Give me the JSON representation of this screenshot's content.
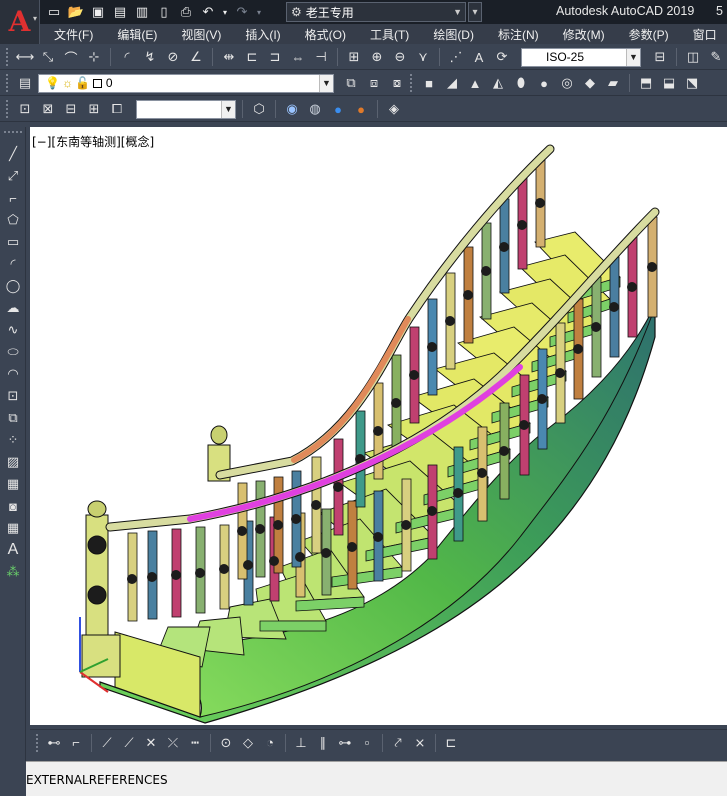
{
  "titlebar": {
    "logo_letter": "A",
    "workspace": "老王专用",
    "app_title": "Autodesk AutoCAD 2019",
    "app_title_extra": "5"
  },
  "menubar": {
    "items": [
      {
        "label": "文件(F)"
      },
      {
        "label": "编辑(E)"
      },
      {
        "label": "视图(V)"
      },
      {
        "label": "插入(I)"
      },
      {
        "label": "格式(O)"
      },
      {
        "label": "工具(T)"
      },
      {
        "label": "绘图(D)"
      },
      {
        "label": "标注(N)"
      },
      {
        "label": "修改(M)"
      },
      {
        "label": "参数(P)"
      },
      {
        "label": "窗口"
      }
    ]
  },
  "toolbars": {
    "dim_style": "ISO-25",
    "layer_name": "0",
    "view_combo": ""
  },
  "viewport": {
    "label": "[−][东南等轴测][概念]"
  },
  "command": {
    "title": "EXTERNALREFERENCES"
  },
  "colors": {
    "ui_bg": "#3b4453",
    "title_bg": "#1a1f27",
    "menu_bg": "#363d4a",
    "viewport_bg": "#ffffff",
    "stair_step_top": "#e8e870",
    "stair_stringer_green": "#5ec04a",
    "stair_stringer_teal": "#2f7f76",
    "handrail": "#d8dca0",
    "handrail_highlight_magenta": "#e040e0",
    "handrail_highlight_orange": "#e08a5a",
    "logo_red": "#e03030"
  },
  "icons": [
    "new-icon",
    "open-icon",
    "save-icon",
    "saveas-icon",
    "publish-icon",
    "mobile-icon",
    "plot-icon",
    "undo-icon",
    "redo-icon",
    "gear-icon"
  ]
}
